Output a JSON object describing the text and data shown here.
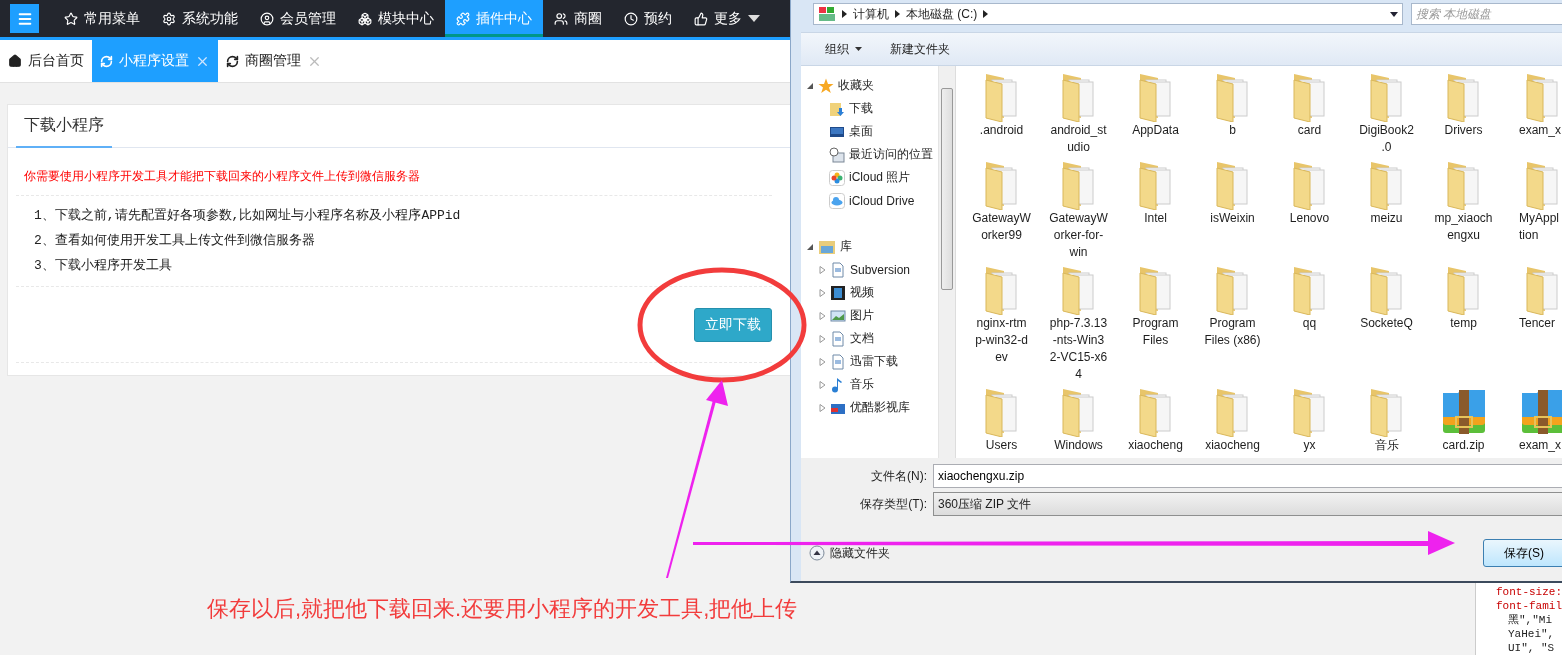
{
  "admin": {
    "navbar": {
      "items": [
        {
          "label": "常用菜单",
          "selected": false,
          "dropdown": false
        },
        {
          "label": "系统功能",
          "selected": false,
          "dropdown": false
        },
        {
          "label": "会员管理",
          "selected": false,
          "dropdown": false
        },
        {
          "label": "模块中心",
          "selected": false,
          "dropdown": false
        },
        {
          "label": "插件中心",
          "selected": true,
          "dropdown": false
        },
        {
          "label": "商圈",
          "selected": false,
          "dropdown": false
        },
        {
          "label": "预约",
          "selected": false,
          "dropdown": false
        },
        {
          "label": "更多",
          "selected": false,
          "dropdown": true
        }
      ]
    },
    "tabs": [
      {
        "label": "后台首页",
        "selected": false,
        "closable": false
      },
      {
        "label": "小程序设置",
        "selected": true,
        "closable": true
      },
      {
        "label": "商圈管理",
        "selected": false,
        "closable": true
      }
    ],
    "card": {
      "title": "下载小程序",
      "notice": "你需要使用小程序开发工具才能把下载回来的小程序文件上传到微信服务器",
      "steps": [
        "1、下载之前,请先配置好各项参数,比如网址与小程序名称及小程序APPid",
        "2、查看如何使用开发工具上传文件到微信服务器",
        "3、下载小程序开发工具"
      ],
      "button": "立即下载"
    }
  },
  "save_dialog": {
    "breadcrumbs": [
      "计算机",
      "本地磁盘 (C:)"
    ],
    "search": {
      "placeholder": "搜索 本地磁盘"
    },
    "toolbar": [
      {
        "label": "组织",
        "dropdown": true
      },
      {
        "label": "新建文件夹",
        "dropdown": false
      }
    ],
    "nav": [
      {
        "label": "收藏夹",
        "expanded": true,
        "children": [
          {
            "label": "下载"
          },
          {
            "label": "桌面"
          },
          {
            "label": "最近访问的位置"
          },
          {
            "label": "iCloud 照片"
          },
          {
            "label": "iCloud Drive"
          }
        ]
      },
      {
        "label": "库",
        "expanded": true,
        "children": [
          {
            "label": "Subversion",
            "expanded": false
          },
          {
            "label": "视频",
            "expanded": false
          },
          {
            "label": "图片",
            "expanded": false
          },
          {
            "label": "文档",
            "expanded": false
          },
          {
            "label": "迅雷下载",
            "expanded": false
          },
          {
            "label": "音乐",
            "expanded": false
          },
          {
            "label": "优酷影视库",
            "expanded": false
          }
        ]
      }
    ],
    "files": [
      {
        "lines": [
          ".android"
        ],
        "kind": "folder"
      },
      {
        "lines": [
          "android_st",
          "udio"
        ],
        "kind": "folder"
      },
      {
        "lines": [
          "AppData"
        ],
        "kind": "folder"
      },
      {
        "lines": [
          "b"
        ],
        "kind": "folder"
      },
      {
        "lines": [
          "card"
        ],
        "kind": "folder"
      },
      {
        "lines": [
          "DigiBook2",
          ".0"
        ],
        "kind": "folder"
      },
      {
        "lines": [
          "Drivers"
        ],
        "kind": "folder"
      },
      {
        "lines": [
          "exam_x"
        ],
        "kind": "folder"
      },
      {
        "lines": [
          "GatewayW",
          "orker99"
        ],
        "kind": "folder"
      },
      {
        "lines": [
          "GatewayW",
          "orker-for-",
          "win"
        ],
        "kind": "folder"
      },
      {
        "lines": [
          "Intel"
        ],
        "kind": "folder"
      },
      {
        "lines": [
          "isWeixin"
        ],
        "kind": "folder"
      },
      {
        "lines": [
          "Lenovo"
        ],
        "kind": "folder"
      },
      {
        "lines": [
          "meizu"
        ],
        "kind": "folder"
      },
      {
        "lines": [
          "mp_xiaoch",
          "engxu"
        ],
        "kind": "folder"
      },
      {
        "lines": [
          "MyAppl",
          "tion"
        ],
        "kind": "folder"
      },
      {
        "lines": [
          "nginx-rtm",
          "p-win32-d",
          "ev"
        ],
        "kind": "folder"
      },
      {
        "lines": [
          "php-7.3.13",
          "-nts-Win3",
          "2-VC15-x6",
          "4"
        ],
        "kind": "folder"
      },
      {
        "lines": [
          "Program",
          "Files"
        ],
        "kind": "folder"
      },
      {
        "lines": [
          "Program",
          "Files (x86)"
        ],
        "kind": "folder"
      },
      {
        "lines": [
          "qq"
        ],
        "kind": "folder"
      },
      {
        "lines": [
          "SocketeQ"
        ],
        "kind": "folder"
      },
      {
        "lines": [
          "temp"
        ],
        "kind": "folder"
      },
      {
        "lines": [
          "Tencer"
        ],
        "kind": "folder"
      },
      {
        "lines": [
          "Users"
        ],
        "kind": "folder"
      },
      {
        "lines": [
          "Windows"
        ],
        "kind": "folder"
      },
      {
        "lines": [
          "xiaocheng"
        ],
        "kind": "folder"
      },
      {
        "lines": [
          "xiaocheng"
        ],
        "kind": "folder"
      },
      {
        "lines": [
          "yx"
        ],
        "kind": "folder"
      },
      {
        "lines": [
          "音乐"
        ],
        "kind": "folder"
      },
      {
        "lines": [
          "card.zip"
        ],
        "kind": "zip"
      },
      {
        "lines": [
          "exam_x"
        ],
        "kind": "zip"
      }
    ],
    "file_name": {
      "label": "文件名(N):",
      "value": "xiaochengxu.zip"
    },
    "save_type": {
      "label": "保存类型(T):",
      "value": "360压缩 ZIP 文件"
    },
    "hide_folders": "隐藏文件夹",
    "save_button": "保存(S)"
  },
  "devtools": {
    "lines": [
      {
        "text": "font-size:",
        "kind": "property"
      },
      {
        "text": "font-famil",
        "kind": "property"
      },
      {
        "text": "黑\",\"Mi",
        "kind": "value"
      },
      {
        "text": "YaHei\",",
        "kind": "value"
      },
      {
        "text": "UI\", \"S",
        "kind": "value"
      }
    ]
  },
  "annotation": {
    "caption": "保存以后,就把他下载回来.还要用小程序的开发工具,把他上传"
  }
}
